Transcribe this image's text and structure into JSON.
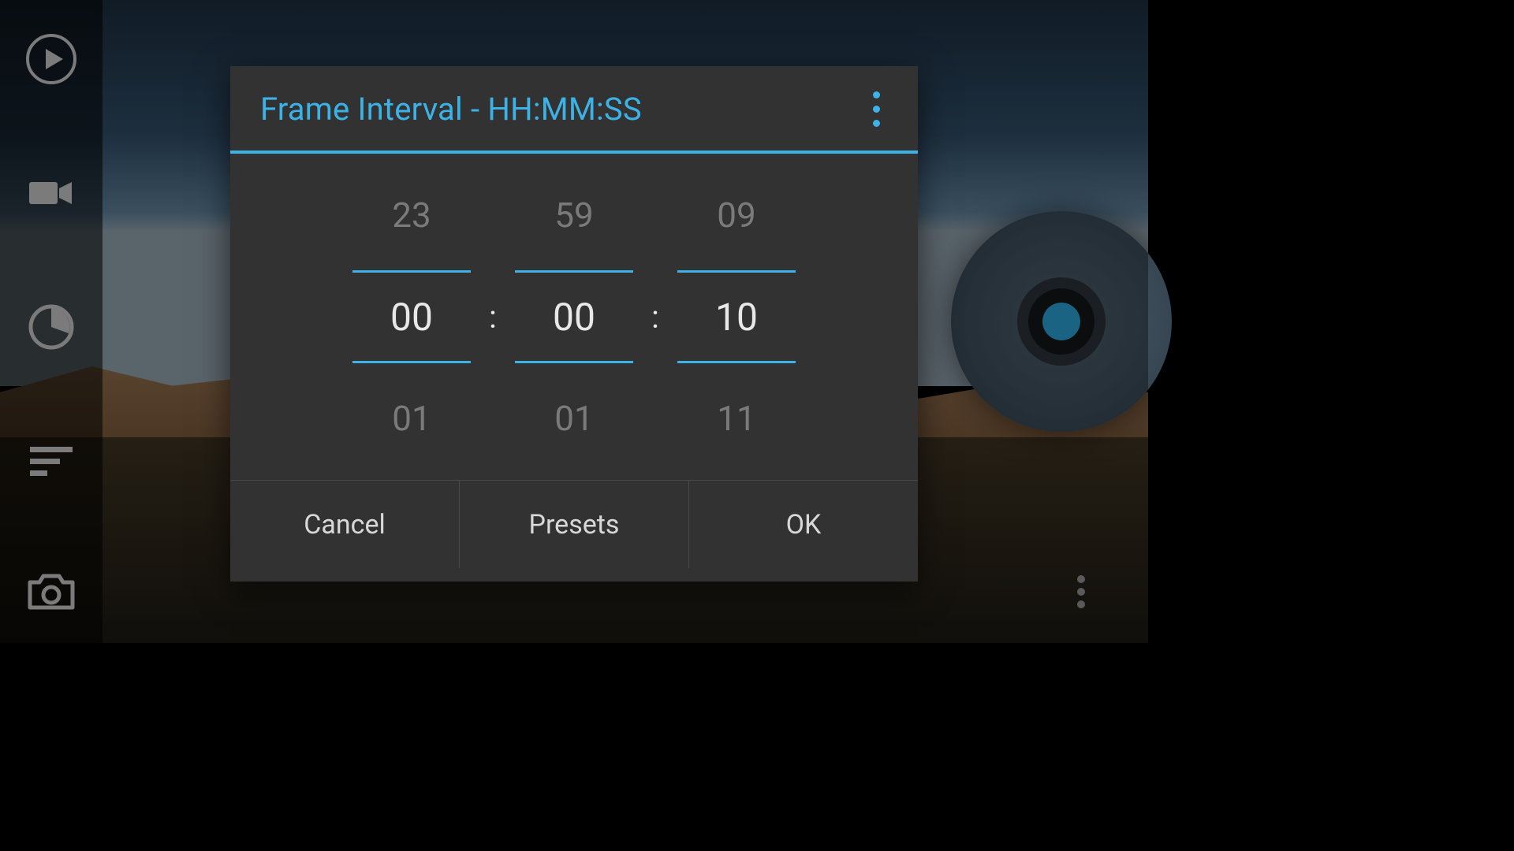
{
  "sidebar": {
    "items": {
      "play": {
        "name": "play-button",
        "icon": "play-circle-icon"
      },
      "video": {
        "name": "video-mode-button",
        "icon": "video-camera-icon"
      },
      "timer": {
        "name": "interval-button",
        "icon": "pie-timer-icon"
      },
      "sort": {
        "name": "settings-list-button",
        "icon": "bars-sort-icon"
      },
      "camera": {
        "name": "still-photo-button",
        "icon": "camera-icon"
      }
    }
  },
  "shutter": {
    "name": "record-shutter-button"
  },
  "overflow_button": {
    "icon": "more-vert-icon"
  },
  "dialog": {
    "title": "Frame Interval - HH:MM:SS",
    "more_icon": "more-vert-icon",
    "picker": {
      "hours": {
        "prev": "23",
        "current": "00",
        "next": "01"
      },
      "minutes": {
        "prev": "59",
        "current": "00",
        "next": "01"
      },
      "seconds": {
        "prev": "09",
        "current": "10",
        "next": "11"
      },
      "separator": ":"
    },
    "buttons": {
      "cancel": "Cancel",
      "presets": "Presets",
      "ok": "OK"
    }
  },
  "colors": {
    "accent": "#3db2e6",
    "dialog_bg": "#323232"
  }
}
